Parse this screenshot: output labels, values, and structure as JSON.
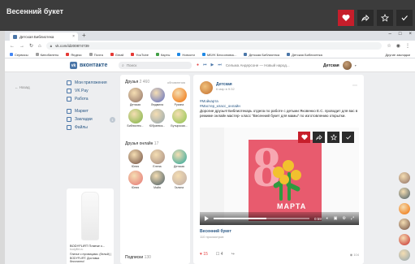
{
  "player": {
    "title": "Весенний букет",
    "buttons": [
      "heart-icon",
      "share-icon",
      "bookmark-icon",
      "check-icon"
    ]
  },
  "browser": {
    "tab_title": "Детская Библиотека",
    "tab_close": "×",
    "new_tab": "+",
    "win_controls": [
      "–",
      "□",
      "×"
    ],
    "url": "vk.com/id200874739",
    "bookmarks": [
      {
        "label": "Сервисы",
        "color": "#4285f4"
      },
      {
        "label": "Кинобилеты",
        "color": "#9e9e9e"
      },
      {
        "label": "Яндекс",
        "color": "#e53935"
      },
      {
        "label": "Почта",
        "color": "#9e9e9e"
      },
      {
        "label": "Gmail",
        "color": "#e53935"
      },
      {
        "label": "YouTube",
        "color": "#e53935"
      },
      {
        "label": "Карты",
        "color": "#43a047"
      },
      {
        "label": "Новости",
        "color": "#1e88e5"
      },
      {
        "label": "МБУК Бессоновск...",
        "color": "#1e88e5"
      },
      {
        "label": "Детская Библиотека",
        "color": "#4a76a8"
      },
      {
        "label": "Детская Библиотека",
        "color": "#4a76a8"
      }
    ],
    "bookmarks_other": "Другие закладки"
  },
  "vk": {
    "brand": "вконтакте",
    "search_placeholder": "Поиск",
    "player_track": "Сельма Андерсоне — Новый народ...",
    "user_name": "Детская",
    "back": "← Назад",
    "menu": [
      {
        "label": "Мои приложения"
      },
      {
        "label": "VK Pay"
      },
      {
        "label": "Работа"
      },
      {
        "label": "Маркет"
      },
      {
        "label": "Закладки",
        "badge": "1"
      },
      {
        "label": "Файлы"
      }
    ],
    "ad": {
      "title": "BODYFLIRT Платье с...",
      "subtitle": "bodyflirt.ru",
      "text": "Платье с пуговицами. (белый) | BODYFLIRT. Доставка бесплатно!"
    },
    "friends": {
      "title": "Друзья",
      "count": "2 460",
      "link": "обновления",
      "items": [
        {
          "name": "Детская",
          "color": "#8d6e63"
        },
        {
          "name": "Людмила",
          "color": "#5c6bc0"
        },
        {
          "name": "Русина",
          "color": "#ef6c00"
        },
        {
          "name": "Библиотек...",
          "color": "#7cb342"
        },
        {
          "name": "Юбраевск...",
          "color": "#90a4ae"
        },
        {
          "name": "Бутырская...",
          "color": "#8bc34a"
        }
      ]
    },
    "friends_online": {
      "title": "Друзья онлайн",
      "count": "17",
      "items": [
        {
          "name": "Юлия",
          "color": "#6d4c41"
        },
        {
          "name": "Елена",
          "color": "#a1887f"
        },
        {
          "name": "Детская",
          "color": "#26a69a"
        },
        {
          "name": "Юлия",
          "color": "#e57373"
        },
        {
          "name": "Майя",
          "color": "#455a64"
        },
        {
          "name": "Галина",
          "color": "#bcaaa4"
        }
      ]
    },
    "subs": {
      "title": "Подписки",
      "count": "130"
    },
    "post": {
      "author": "Детская",
      "time": "6 мар в 9:32",
      "tag1": "#Мойкарта",
      "tag2": "#Мастер_класс_онлайн",
      "text": "Дорогие друзья! Библиотекарь отдела по работе с детьми Яковенко Е.С. проводит для вас в режиме онлайн мастер- класс \"Весенний букет для мамы\" по изготовлению открытки.",
      "video": {
        "digit": "8",
        "word": "МАРТА",
        "time": "0:59",
        "progress": 0.55,
        "buttons": [
          "heart-icon",
          "share-icon",
          "bookmark-icon",
          "check-icon"
        ]
      },
      "video_title": "Весенний букет",
      "video_views": "110 просмотров",
      "likes": "15",
      "comments": "4",
      "views": "104"
    },
    "side_avatars": [
      "#8d6e63",
      "#455a64",
      "#ef6c00",
      "#6d4c41",
      "#c62828",
      "#90a4ae"
    ]
  }
}
